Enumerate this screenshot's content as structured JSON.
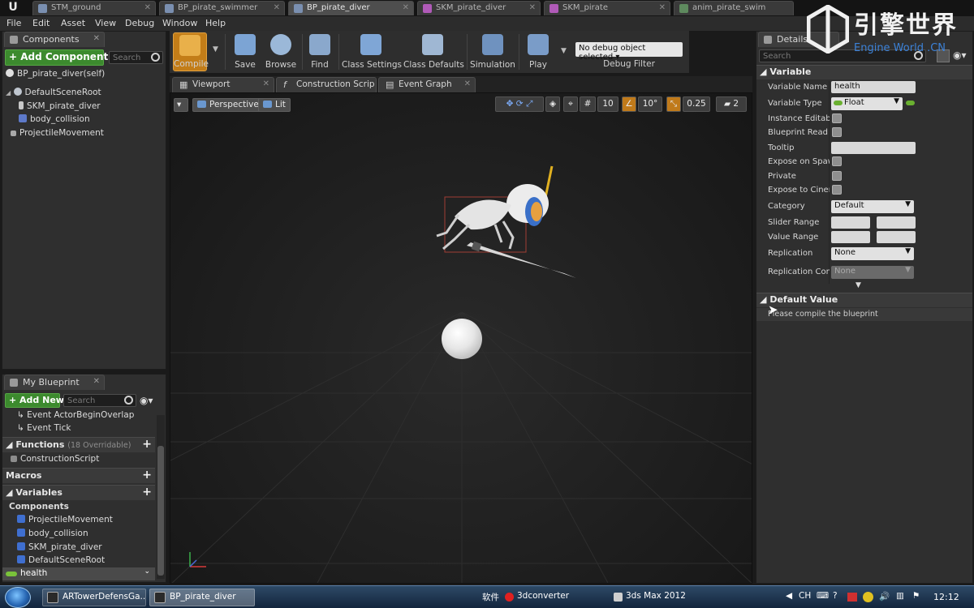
{
  "doc_tabs": [
    {
      "label": "STM_ground"
    },
    {
      "label": "BP_pirate_swimmer"
    },
    {
      "label": "BP_pirate_diver"
    },
    {
      "label": "SKM_pirate_diver"
    },
    {
      "label": "SKM_pirate"
    },
    {
      "label": "anim_pirate_swim"
    }
  ],
  "menu": [
    "File",
    "Edit",
    "Asset",
    "View",
    "Debug",
    "Window",
    "Help"
  ],
  "watermark": {
    "cn": "引擎世界",
    "en": "Engine World .CN"
  },
  "components_panel": {
    "tab_label": "Components",
    "add_button": "+ Add Component ▾",
    "search_placeholder": "Search",
    "self_label": "BP_pirate_diver(self)",
    "tree": [
      {
        "label": "DefaultSceneRoot"
      },
      {
        "label": "SKM_pirate_diver"
      },
      {
        "label": "body_collision"
      },
      {
        "label": "ProjectileMovement"
      }
    ]
  },
  "blueprint_panel": {
    "tab_label": "My Blueprint",
    "add_new": "+ Add New ▾",
    "search_placeholder": "Search",
    "events": [
      "Event ActorBeginOverlap",
      "Event Tick"
    ],
    "functions_header": "Functions",
    "functions_note": "(18 Overridable)",
    "functions": [
      "ConstructionScript"
    ],
    "macros_header": "Macros",
    "variables_header": "Variables",
    "components_header": "Components",
    "component_vars": [
      "ProjectileMovement",
      "body_collision",
      "SKM_pirate_diver",
      "DefaultSceneRoot"
    ],
    "selected_var": "health"
  },
  "toolbar": {
    "compile": "Compile",
    "save": "Save",
    "browse": "Browse",
    "find": "Find",
    "class_settings": "Class Settings",
    "class_defaults": "Class Defaults",
    "simulation": "Simulation",
    "play": "Play",
    "debug_object": "No debug object selected ▾",
    "debug_filter": "Debug Filter"
  },
  "editor_tabs": [
    {
      "label": "Viewport"
    },
    {
      "label": "Construction Scrip"
    },
    {
      "label": "Event Graph"
    }
  ],
  "viewport": {
    "perspective": "Perspective",
    "lit": "Lit",
    "grid_snap": "10",
    "rot_snap": "10°",
    "scale_snap": "0.25",
    "camera_speed": "2"
  },
  "details": {
    "tab_label": "Details",
    "search_placeholder": "Search",
    "variable_section": "Variable",
    "props": {
      "variable_name_label": "Variable Name",
      "variable_name": "health",
      "variable_type_label": "Variable Type",
      "variable_type": "Float",
      "instance_editable_label": "Instance Editable",
      "bp_read_only_label": "Blueprint Read Only",
      "tooltip_label": "Tooltip",
      "expose_spawn_label": "Expose on Spawn",
      "private_label": "Private",
      "expose_cinematics_label": "Expose to Cinematics",
      "category_label": "Category",
      "category": "Default",
      "slider_range_label": "Slider Range",
      "value_range_label": "Value Range",
      "replication_label": "Replication",
      "replication": "None",
      "replication_condition_label": "Replication Condition",
      "replication_condition": "None"
    },
    "default_value_section": "Default Value",
    "default_value_msg": "Please compile the blueprint"
  },
  "taskbar": {
    "tasks": [
      {
        "label": "ARTowerDefensGa..."
      },
      {
        "label": "BP_pirate_diver"
      }
    ],
    "tray_software": "软件",
    "tray_app1": "3dconverter",
    "tray_app2": "3ds Max 2012",
    "lang": "CH",
    "clock": "12:12"
  },
  "colors": {
    "compile_orange": "#c37d18",
    "add_green": "#3c8a2e",
    "watermark_blue": "#3c82d8"
  }
}
